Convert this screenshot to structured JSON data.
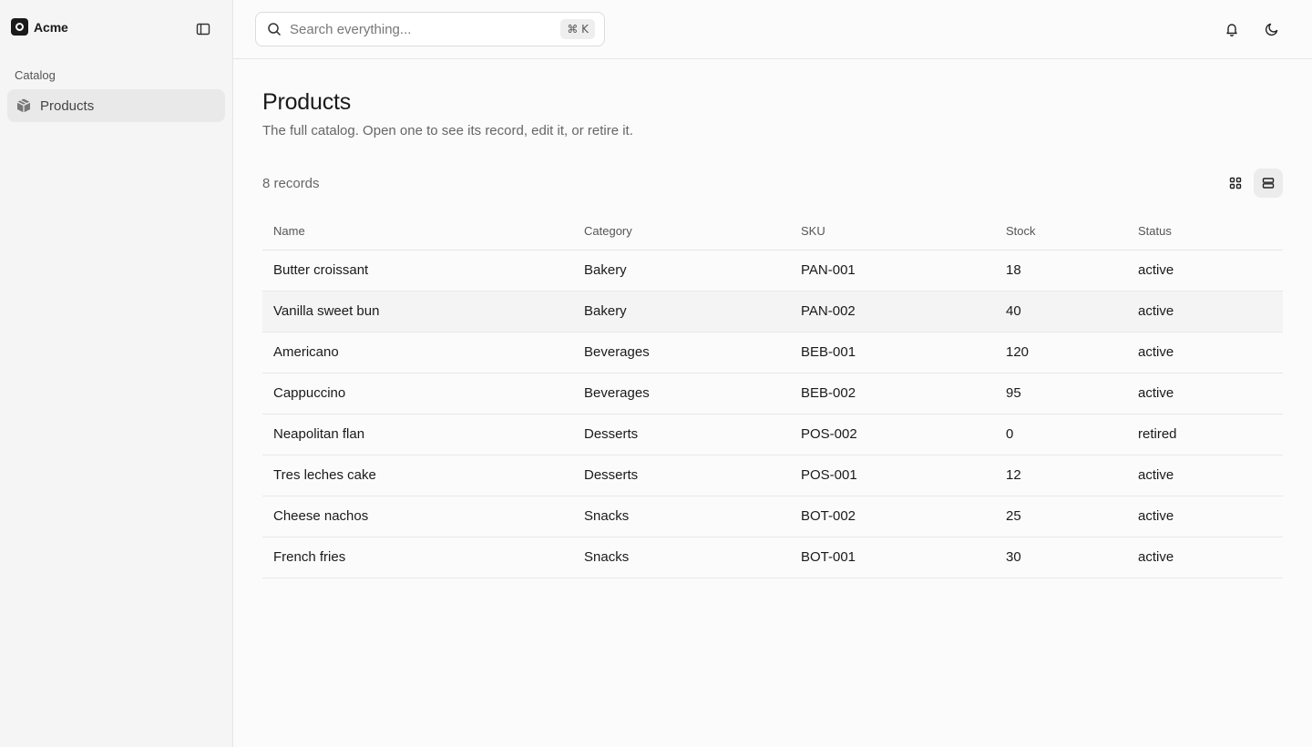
{
  "brand": {
    "name": "Acme"
  },
  "sidebar": {
    "section_label": "Catalog",
    "items": [
      {
        "label": "Products",
        "icon": "box-icon",
        "active": true
      }
    ]
  },
  "search": {
    "placeholder": "Search everything...",
    "shortcut": "⌘ K"
  },
  "page": {
    "title": "Products",
    "subtitle": "The full catalog. Open one to see its record, edit it, or retire it.",
    "record_count": "8 records"
  },
  "table": {
    "columns": [
      "Name",
      "Category",
      "SKU",
      "Stock",
      "Status"
    ],
    "rows": [
      [
        "Butter croissant",
        "Bakery",
        "PAN-001",
        "18",
        "active"
      ],
      [
        "Vanilla sweet bun",
        "Bakery",
        "PAN-002",
        "40",
        "active"
      ],
      [
        "Americano",
        "Beverages",
        "BEB-001",
        "120",
        "active"
      ],
      [
        "Cappuccino",
        "Beverages",
        "BEB-002",
        "95",
        "active"
      ],
      [
        "Neapolitan flan",
        "Desserts",
        "POS-002",
        "0",
        "retired"
      ],
      [
        "Tres leches cake",
        "Desserts",
        "POS-001",
        "12",
        "active"
      ],
      [
        "Cheese nachos",
        "Snacks",
        "BOT-002",
        "25",
        "active"
      ],
      [
        "French fries",
        "Snacks",
        "BOT-001",
        "30",
        "active"
      ]
    ]
  },
  "colors": {
    "accent": "#1a1a1a",
    "sidebar_bg": "#f5f5f5",
    "active_item_bg": "#e9e9e9"
  }
}
